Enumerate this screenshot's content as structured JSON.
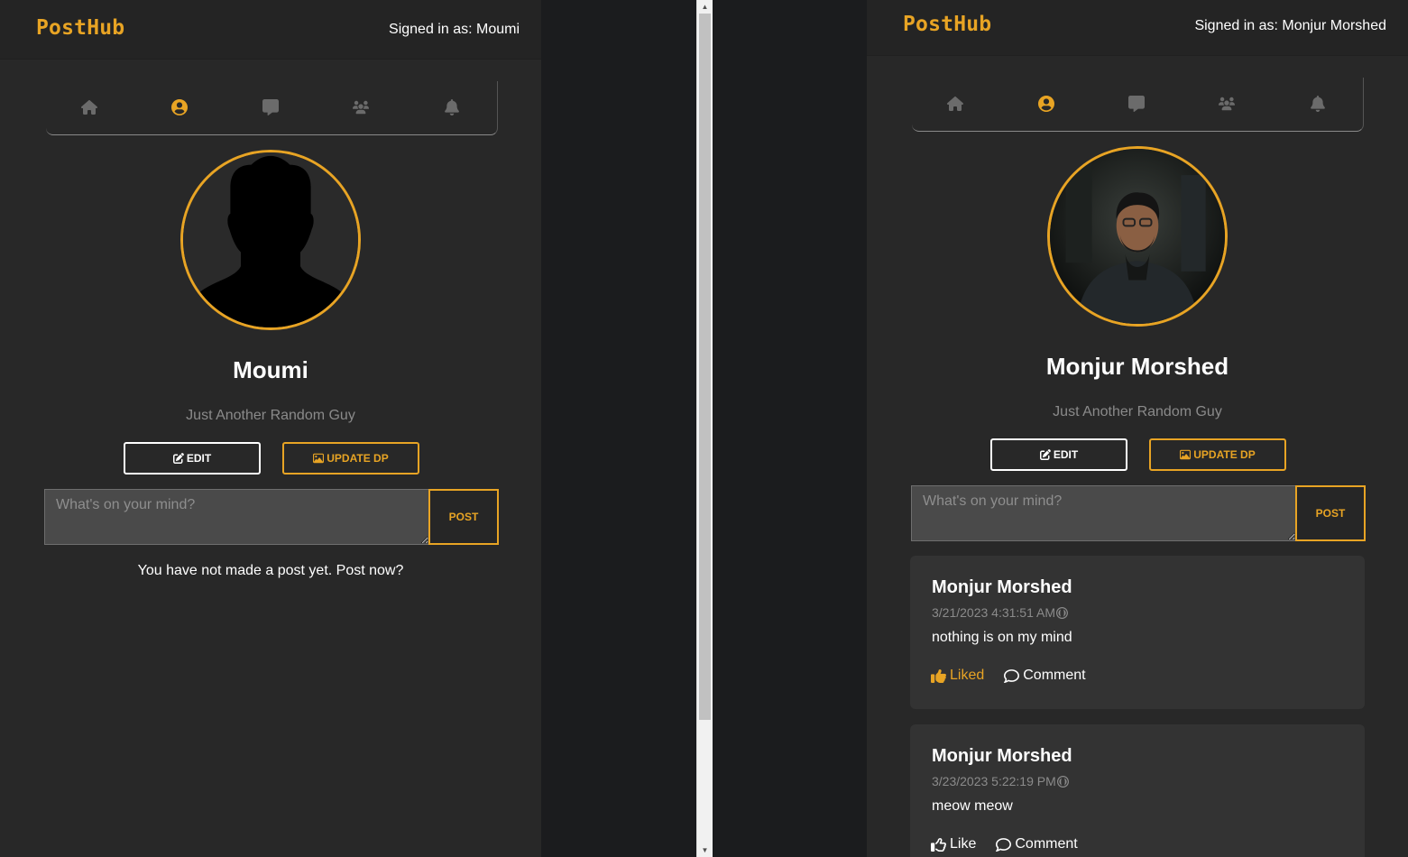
{
  "brand": {
    "logo": "PostHub",
    "accent_color": "#e8a424"
  },
  "left": {
    "signed_in_label": "Signed in as: Moumi",
    "nav_icons": [
      "home-icon",
      "user-circle-icon",
      "comment-icon",
      "users-icon",
      "bell-icon"
    ],
    "active_nav": "profile",
    "profile": {
      "name": "Moumi",
      "bio": "Just Another Random Guy",
      "avatar": "default-silhouette"
    },
    "edit_label": "EDIT",
    "update_dp_label": "UPDATE DP",
    "composer_placeholder": "What's on your mind?",
    "post_label": "POST",
    "empty_message": "You have not made a post yet. Post now?"
  },
  "right": {
    "signed_in_label": "Signed in as: Monjur Morshed",
    "nav_icons": [
      "home-icon",
      "user-circle-icon",
      "comment-icon",
      "users-icon",
      "bell-icon"
    ],
    "active_nav": "profile",
    "profile": {
      "name": "Monjur Morshed",
      "bio": "Just Another Random Guy",
      "avatar": "profile-photo"
    },
    "edit_label": "EDIT",
    "update_dp_label": "UPDATE DP",
    "composer_placeholder": "What's on your mind?",
    "post_label": "POST",
    "posts": [
      {
        "author": "Monjur Morshed",
        "timestamp": "3/21/2023 4:31:51 AM",
        "body": "nothing is on my mind",
        "like_label": "Liked",
        "liked": true,
        "comment_label": "Comment"
      },
      {
        "author": "Monjur Morshed",
        "timestamp": "3/23/2023 5:22:19 PM",
        "body": "meow meow",
        "like_label": "Like",
        "liked": false,
        "comment_label": "Comment"
      }
    ]
  }
}
